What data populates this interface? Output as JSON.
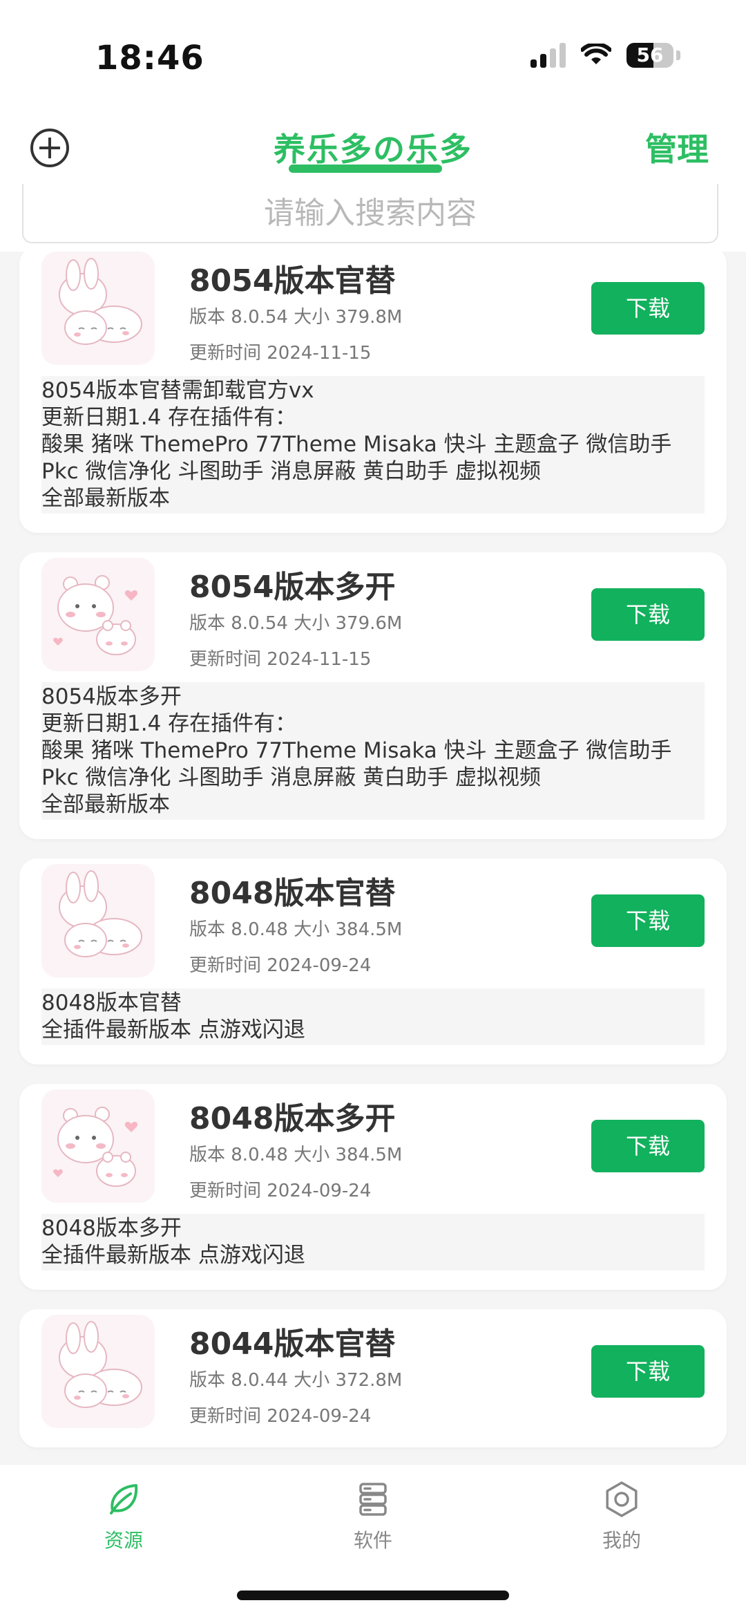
{
  "status_bar": {
    "time": "18:46",
    "battery": "56"
  },
  "header": {
    "title": "养乐多の乐多",
    "manage_label": "管理",
    "add_icon": "plus-circle-icon"
  },
  "search": {
    "placeholder": "请输入搜索内容"
  },
  "colors": {
    "accent": "#2dbe63",
    "download_button": "#12b15d"
  },
  "items": [
    {
      "title": "8054版本官替",
      "meta": "版本 8.0.54 大小 379.8M",
      "updated": "更新时间 2024-11-15",
      "download_label": "下载",
      "thumb_icon": "bunny-cat-sticker-icon",
      "description": [
        "8054版本官替需卸载官方vx",
        "更新日期1.4 存在插件有：",
        "酸果 猪咪 ThemePro 77Theme Misaka 快斗 主题盒子 微信助手",
        "Pkc 微信净化 斗图助手 消息屏蔽 黄白助手 虚拟视频",
        "全部最新版本"
      ]
    },
    {
      "title": "8054版本多开",
      "meta": "版本 8.0.54 大小 379.6M",
      "updated": "更新时间 2024-11-15",
      "download_label": "下载",
      "thumb_icon": "bears-heart-sticker-icon",
      "description": [
        "8054版本多开",
        "更新日期1.4 存在插件有：",
        "酸果 猪咪 ThemePro 77Theme Misaka 快斗 主题盒子 微信助手",
        "Pkc 微信净化 斗图助手 消息屏蔽 黄白助手 虚拟视频",
        "全部最新版本"
      ]
    },
    {
      "title": "8048版本官替",
      "meta": "版本 8.0.48 大小 384.5M",
      "updated": "更新时间 2024-09-24",
      "download_label": "下载",
      "thumb_icon": "bunny-cat-sticker-icon",
      "description": [
        "8048版本官替",
        "全插件最新版本 点游戏闪退"
      ]
    },
    {
      "title": "8048版本多开",
      "meta": "版本 8.0.48 大小 384.5M",
      "updated": "更新时间 2024-09-24",
      "download_label": "下载",
      "thumb_icon": "bears-heart-sticker-icon",
      "description": [
        "8048版本多开",
        "全插件最新版本 点游戏闪退"
      ]
    },
    {
      "title": "8044版本官替",
      "meta": "版本 8.0.44 大小 372.8M",
      "updated": "更新时间 2024-09-24",
      "download_label": "下载",
      "thumb_icon": "bunny-cat-sticker-icon",
      "description": []
    }
  ],
  "tabbar": {
    "tabs": [
      {
        "label": "资源",
        "icon": "leaf-icon",
        "active": true
      },
      {
        "label": "软件",
        "icon": "database-icon",
        "active": false
      },
      {
        "label": "我的",
        "icon": "gear-icon",
        "active": false
      }
    ]
  }
}
